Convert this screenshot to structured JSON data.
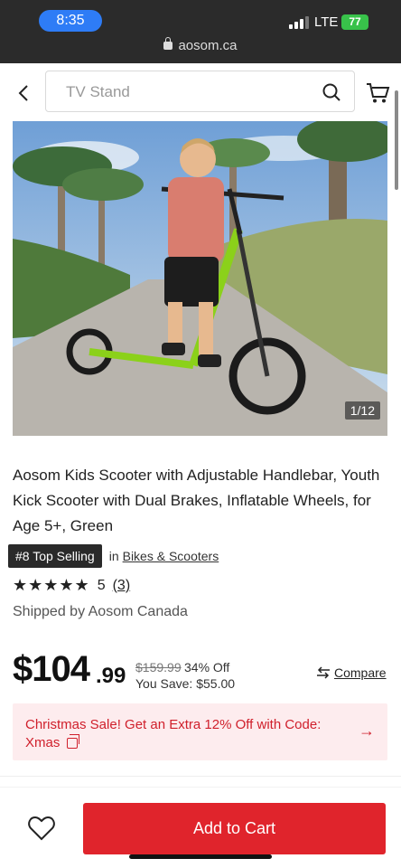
{
  "status_bar": {
    "time": "8:35",
    "network": "LTE",
    "battery": "77",
    "url": "aosom.ca"
  },
  "header": {
    "search_placeholder": "TV Stand",
    "back_icon": "chevron-left-icon",
    "search_icon": "search-icon",
    "cart_icon": "cart-icon"
  },
  "gallery": {
    "counter": "1/12"
  },
  "product": {
    "title": "Aosom Kids Scooter with Adjustable Handlebar, Youth Kick Scooter with Dual Brakes, Inflatable Wheels, for Age 5+, Green",
    "badge": "#8 Top Selling",
    "in_label": "in",
    "category": "Bikes & Scooters",
    "stars": "★★★★★",
    "rating": "5",
    "review_count": "(3)",
    "shipped_by": "Shipped by Aosom Canada"
  },
  "price": {
    "main": "$104",
    "cents": ".99",
    "old_price": "$159.99",
    "discount": "34% Off",
    "you_save": "You Save: $55.00",
    "compare_label": "Compare"
  },
  "promo": {
    "text": "Christmas Sale! Get an Extra 12% Off with Code: Xmas",
    "arrow": "→"
  },
  "bottom_bar": {
    "add_to_cart": "Add to Cart"
  },
  "colors": {
    "accent": "#e0242c",
    "promo_bg": "#fdecee",
    "promo_text": "#d0202c",
    "time_pill": "#2e7cf6",
    "battery": "#38c24a"
  }
}
